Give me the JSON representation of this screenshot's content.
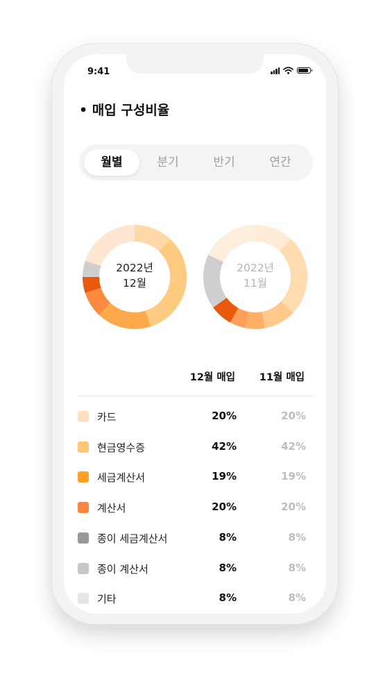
{
  "status_bar": {
    "time": "9:41",
    "icons": [
      "signal-icon",
      "wifi-icon",
      "battery-icon"
    ]
  },
  "section": {
    "bullet": "•",
    "title": "매입 구성비율"
  },
  "period_tabs": [
    {
      "label": "월별",
      "active": true
    },
    {
      "label": "분기",
      "active": false
    },
    {
      "label": "반기",
      "active": false
    },
    {
      "label": "연간",
      "active": false
    }
  ],
  "donuts": [
    {
      "line1": "2022년",
      "line2": "12월",
      "text_color": "#222222",
      "segments": [
        {
          "color": "#FFD8A8",
          "value": 12
        },
        {
          "color": "#FFCB80",
          "value": 33
        },
        {
          "color": "#FFA94D",
          "value": 17
        },
        {
          "color": "#FF8A3D",
          "value": 8
        },
        {
          "color": "#E8590C",
          "value": 5
        },
        {
          "color": "#CFCFCF",
          "value": 5
        },
        {
          "color": "#FDE7D2",
          "value": 20
        }
      ]
    },
    {
      "line1": "2022년",
      "line2": "11월",
      "text_color": "#b5b5b5",
      "segments": [
        {
          "color": "#FFEBD6",
          "value": 12
        },
        {
          "color": "#FFDCB0",
          "value": 25
        },
        {
          "color": "#FFC98A",
          "value": 10
        },
        {
          "color": "#FFB066",
          "value": 6
        },
        {
          "color": "#FF9F5A",
          "value": 5
        },
        {
          "color": "#E8590C",
          "value": 7
        },
        {
          "color": "#CFCFCF",
          "value": 17
        },
        {
          "color": "#FDEDDD",
          "value": 18
        }
      ]
    }
  ],
  "table": {
    "headers": {
      "dec": "12월 매입",
      "nov": "11월 매입"
    },
    "rows": [
      {
        "label": "카드",
        "color": "#FFE0C2",
        "dec": "20%",
        "nov": "20%"
      },
      {
        "label": "현금영수증",
        "color": "#FFC678",
        "dec": "42%",
        "nov": "42%"
      },
      {
        "label": "세금계산서",
        "color": "#FFA023",
        "dec": "19%",
        "nov": "19%"
      },
      {
        "label": "계산서",
        "color": "#FF8440",
        "dec": "20%",
        "nov": "20%"
      },
      {
        "label": "종이 세금계산서",
        "color": "#999999",
        "dec": "8%",
        "nov": "8%"
      },
      {
        "label": "종이 계산서",
        "color": "#C7C7C7",
        "dec": "8%",
        "nov": "8%"
      },
      {
        "label": "기타",
        "color": "#E6E6E6",
        "dec": "8%",
        "nov": "8%"
      }
    ]
  }
}
